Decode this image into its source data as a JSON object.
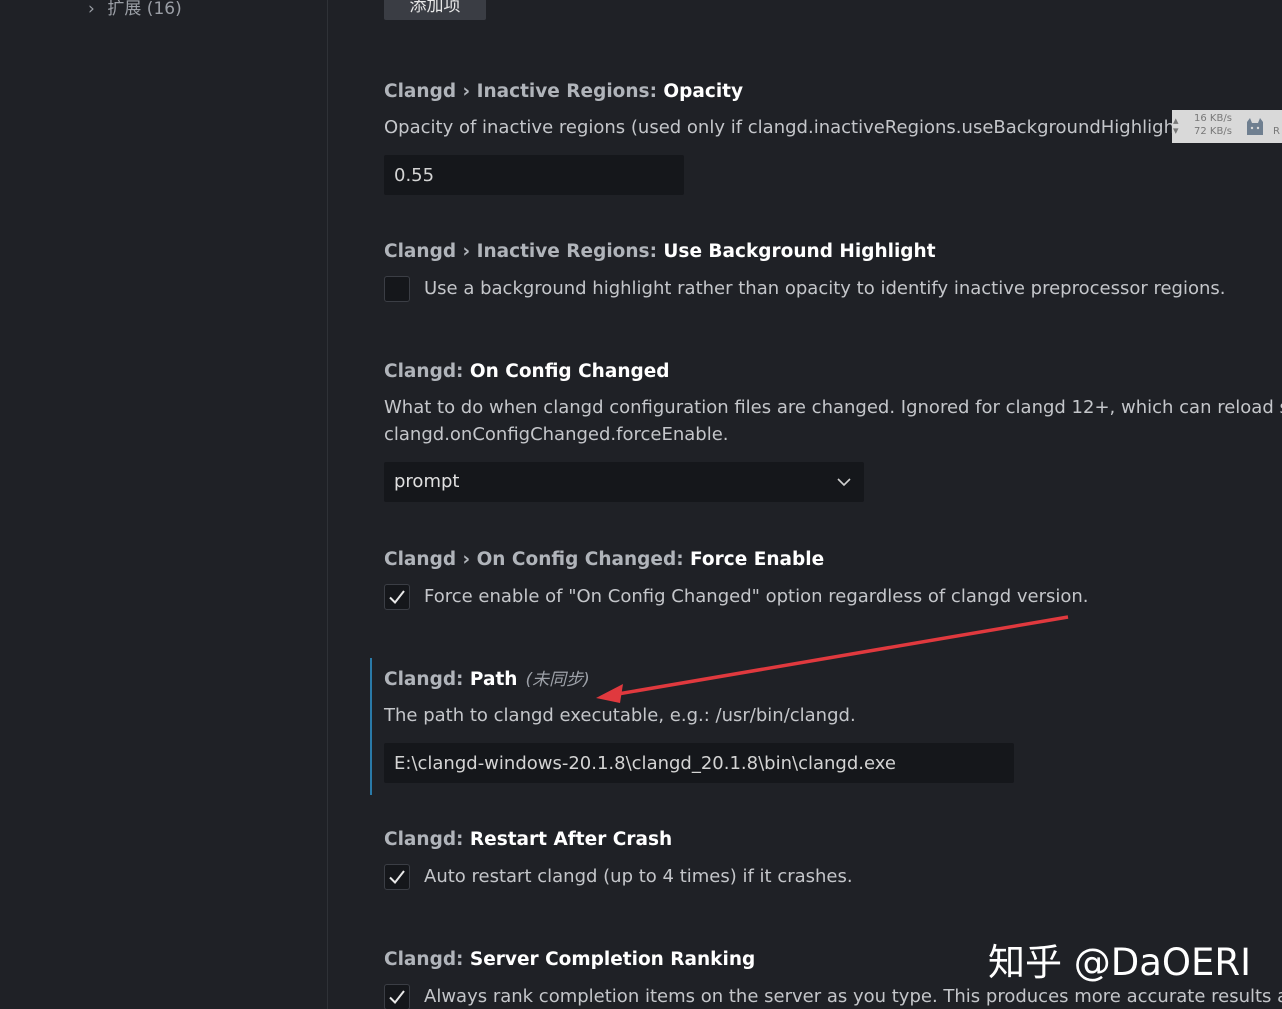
{
  "toc": {
    "item_label": "扩展 (16)"
  },
  "add_item_button": "添加项",
  "settings": [
    {
      "category": "Clangd › Inactive Regions: ",
      "name": "Opacity",
      "description": "Opacity of inactive regions (used only if clangd.inactiveRegions.useBackgroundHighlight=false)",
      "value": "0.55"
    },
    {
      "category": "Clangd › Inactive Regions: ",
      "name": "Use Background Highlight",
      "checked": false,
      "label": "Use a background highlight rather than opacity to identify inactive preprocessor regions."
    },
    {
      "category": "Clangd: ",
      "name": "On Config Changed",
      "description_line1": "What to do when clangd configuration files are changed. Ignored for clangd 12+, which can reload such",
      "description_line2": "clangd.onConfigChanged.forceEnable.",
      "selected": "prompt"
    },
    {
      "category": "Clangd › On Config Changed: ",
      "name": "Force Enable",
      "checked": true,
      "label": "Force enable of \"On Config Changed\" option regardless of clangd version."
    },
    {
      "category": "Clangd: ",
      "name": "Path",
      "sync_note": "(未同步)",
      "description": "The path to clangd executable, e.g.: /usr/bin/clangd.",
      "value": "E:\\clangd-windows-20.1.8\\clangd_20.1.8\\bin\\clangd.exe"
    },
    {
      "category": "Clangd: ",
      "name": "Restart After Crash",
      "checked": true,
      "label": "Auto restart clangd (up to 4 times) if it crashes."
    },
    {
      "category": "Clangd: ",
      "name": "Server Completion Ranking",
      "checked": true,
      "label": "Always rank completion items on the server as you type. This produces more accurate results at the"
    }
  ],
  "net_monitor": {
    "upload": "16 KB/s",
    "download": "72 KB/s",
    "tag": "R"
  },
  "watermark": "知乎 @DaOERI",
  "colors": {
    "background": "#1f2126",
    "input_bg": "#15171b",
    "modified_bar": "#2a7aa8",
    "annotation_arrow": "#e0393e"
  }
}
